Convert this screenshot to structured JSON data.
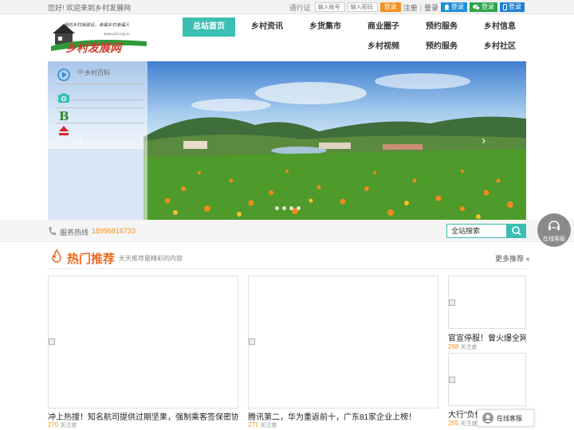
{
  "topbar": {
    "welcome": "您好! 欢迎来到乡村发展网",
    "passport_label": "通行证",
    "account_placeholder": "输入帐号",
    "password_placeholder": "输入密码",
    "login_button": "登录",
    "register_link": "注册",
    "sep": "|",
    "login_link": "登录",
    "qq_login": "登录",
    "wechat_login": "登录",
    "phone_login": "登录"
  },
  "logo": {
    "slogan": "我的乡村我建设，幸福乡村幸福人",
    "name": "乡村发展网",
    "url": "www.xcfz.org.cn"
  },
  "nav": {
    "items": [
      "总站首页",
      "乡村资讯",
      "乡货集市",
      "商业圈子",
      "预约服务",
      "乡村信息",
      "乡村视频",
      "预约服务",
      "乡村社区"
    ]
  },
  "banner": {
    "side_label": "乡村百科",
    "prev": "‹",
    "next": "›"
  },
  "service": {
    "hotline_label": "服务热线",
    "hotline_number": "18996816733",
    "search_placeholder": "全站搜索"
  },
  "hot": {
    "title": "热门推荐",
    "subtitle": "天天推荐最精彩的内容",
    "more": "更多推荐 »",
    "unit": "关注度",
    "cards": [
      {
        "title": "冲上热搜！知名航司提供过期坚果，强制乘客签保密协议?",
        "count": "270"
      },
      {
        "title": "腾讯第二，华为重返前十，广东81家企业上榜！",
        "count": "271"
      },
      {
        "title": "官宣停服！曾火爆全网",
        "count": "268"
      },
      {
        "title": "大行\"负债端\"发力：多家",
        "count": "255"
      }
    ]
  },
  "floating": {
    "bubble_label": "在线客服",
    "bar_label": "在线客服"
  },
  "colors": {
    "accent": "#3bbfb2",
    "orange": "#f29321",
    "hot_title": "#ec6a1f"
  }
}
